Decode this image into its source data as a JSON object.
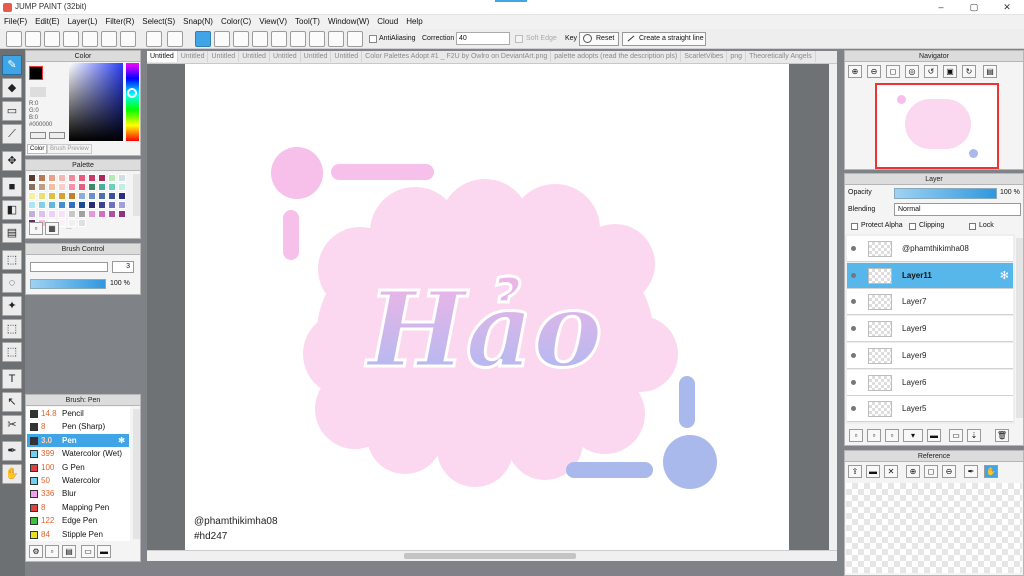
{
  "app": {
    "title": "JUMP PAINT (32bit)"
  },
  "window_controls": [
    "–",
    "▢",
    "✕"
  ],
  "menu": [
    "File(F)",
    "Edit(E)",
    "Layer(L)",
    "Filter(R)",
    "Select(S)",
    "Snap(N)",
    "Color(C)",
    "View(V)",
    "Tool(T)",
    "Window(W)",
    "Cloud",
    "Help"
  ],
  "toolbar": {
    "antialiasing_label": "AntiAliasing",
    "correction_label": "Correction",
    "correction_value": "40",
    "soft_edge_label": "Soft Edge",
    "key_label": "Key",
    "reset_label": "Reset",
    "straight_line_label": "Create a straight line"
  },
  "tabs": [
    "Untitled",
    "Untitled",
    "Untitled",
    "Untitled",
    "Untitled",
    "Untitled",
    "Untitled",
    "Color Palettes Adopt #1 _ F2U by Owlro on DeviantArt.png",
    "palette adopts (read the description pls)",
    "ScarletVibes",
    "png",
    "Theoretically Angels"
  ],
  "color_panel": {
    "title": "Color",
    "r": "R:0",
    "g": "G:0",
    "b": "B:0",
    "hex": "#000000",
    "tab_color": "Color",
    "tab_brush_preview": "Brush Preview",
    "primary": "#000000",
    "secondary": "#ffffff"
  },
  "palette_panel": {
    "title": "Palette",
    "colors": [
      "#5a3a30",
      "#b87955",
      "#e8a28a",
      "#f5b8b0",
      "#f08a9a",
      "#e85a7a",
      "#c83a6a",
      "#a82a5a",
      "#b8e8b8",
      "#d0e0e0",
      "#8a7060",
      "#c0a080",
      "#f0c0a0",
      "#f8d0c8",
      "#f890a8",
      "#e06080",
      "#3a8a6a",
      "#4ab09a",
      "#6ad0c0",
      "#c0f0e0",
      "#f8f0a0",
      "#e8e070",
      "#e0c040",
      "#d8a030",
      "#c08030",
      "#8ab0d8",
      "#6a90c8",
      "#4a70b0",
      "#3a50a0",
      "#2a3080",
      "#a8e8f0",
      "#80d0e8",
      "#60b8e0",
      "#4090d0",
      "#3070c0",
      "#1a4a90",
      "#2a2a70",
      "#404090",
      "#7070c0",
      "#a0a0e0",
      "#c0b0e0",
      "#e0c0f0",
      "#f0d0f8",
      "#f8e0f8",
      "#c8c8c8",
      "#a0a0a0",
      "#e898d8",
      "#d070c0",
      "#b050a0",
      "#903080",
      "#6a2a6a",
      "#f8c0d8",
      "#ffffff",
      "#fff0f8",
      "#f0f0f0",
      "#e0e0e0"
    ],
    "more": "..."
  },
  "brush_control": {
    "title": "Brush Control",
    "size_value": "3",
    "opacity_value": "100 %"
  },
  "brush_panel": {
    "title": "Brush: Pen",
    "items": [
      {
        "size": "14.8",
        "name": "Pencil",
        "color": "#333333"
      },
      {
        "size": "8",
        "name": "Pen (Sharp)",
        "color": "#333333"
      },
      {
        "size": "3.0",
        "name": "Pen",
        "color": "#333333",
        "selected": true
      },
      {
        "size": "399",
        "name": "Watercolor (Wet)",
        "color": "#6fd0f0"
      },
      {
        "size": "100",
        "name": "G Pen",
        "color": "#e04040"
      },
      {
        "size": "50",
        "name": "Watercolor",
        "color": "#6fd0f0"
      },
      {
        "size": "336",
        "name": "Blur",
        "color": "#f0a0f0"
      },
      {
        "size": "8",
        "name": "Mapping Pen",
        "color": "#e04040"
      },
      {
        "size": "122",
        "name": "Edge Pen",
        "color": "#40c040"
      },
      {
        "size": "84",
        "name": "Stipple Pen",
        "color": "#e8e020"
      }
    ]
  },
  "canvas": {
    "artwork_text": "Hảo",
    "signature_line1": "@phamthikimha08",
    "signature_line2": "#hd247"
  },
  "navigator": {
    "title": "Navigator"
  },
  "layer_panel": {
    "title": "Layer",
    "opacity_label": "Opacity",
    "opacity_value": "100 %",
    "blending_label": "Blending",
    "blending_value": "Normal",
    "protect_alpha_label": "Protect Alpha",
    "clipping_label": "Clipping",
    "lock_label": "Lock",
    "layers": [
      {
        "name": "@phamthikimha08"
      },
      {
        "name": "Layer11",
        "selected": true
      },
      {
        "name": "Layer7"
      },
      {
        "name": "Layer9"
      },
      {
        "name": "Layer9"
      },
      {
        "name": "Layer6"
      },
      {
        "name": "Layer5"
      }
    ]
  },
  "reference_panel": {
    "title": "Reference"
  },
  "accent_color": "#3fa5e6"
}
